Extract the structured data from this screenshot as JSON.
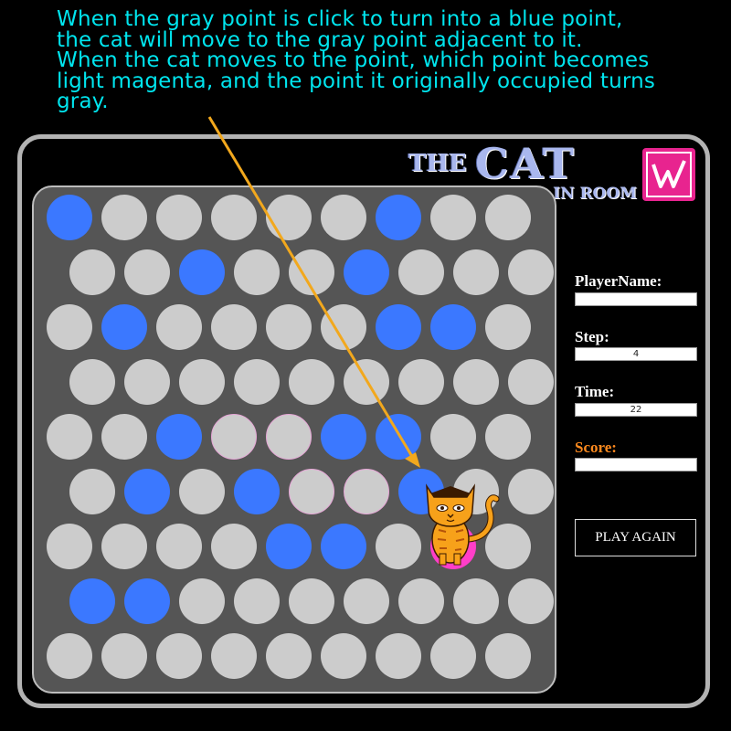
{
  "annotation": {
    "lines": [
      "When the gray point is click to turn into a blue point,",
      "the cat will move to the gray point adjacent to it.",
      "When the cat moves to the point, which point becomes",
      "light magenta, and the point it originally occupied turns",
      "gray."
    ]
  },
  "logo": {
    "the": "THE",
    "cat": "CAT",
    "room": "IN ROOM"
  },
  "sidebar": {
    "player_label": "PlayerName:",
    "player_value": "",
    "step_label": "Step:",
    "step_value": "4",
    "time_label": "Time:",
    "time_value": "22",
    "score_label": "Score:",
    "score_value": "",
    "play_again": "PLAY AGAIN"
  },
  "board": {
    "rows": [
      "BGGGGGBGG",
      "GGBGGBGGG",
      "GBGGGGBBG",
      "GGGGGGGGG",
      "GGBGGBBGG",
      "GBGBGGBGG",
      "GGGGBBGCG",
      "BBGGGGGGG",
      "GGGGGGGGG"
    ],
    "legend": {
      "G": "gray point",
      "B": "blue point",
      "C": "cat point"
    }
  },
  "colors": {
    "gray_point": "#cccccc",
    "blue_point": "#3b78ff",
    "cat_point": "#ff3ec8",
    "annotation": "#00e5ee",
    "arrow": "#f2a81d",
    "score_label": "#ff8a1e",
    "board_bg": "#555555"
  },
  "icons": {
    "badge": "w-logo-icon",
    "cat": "cat-icon"
  }
}
